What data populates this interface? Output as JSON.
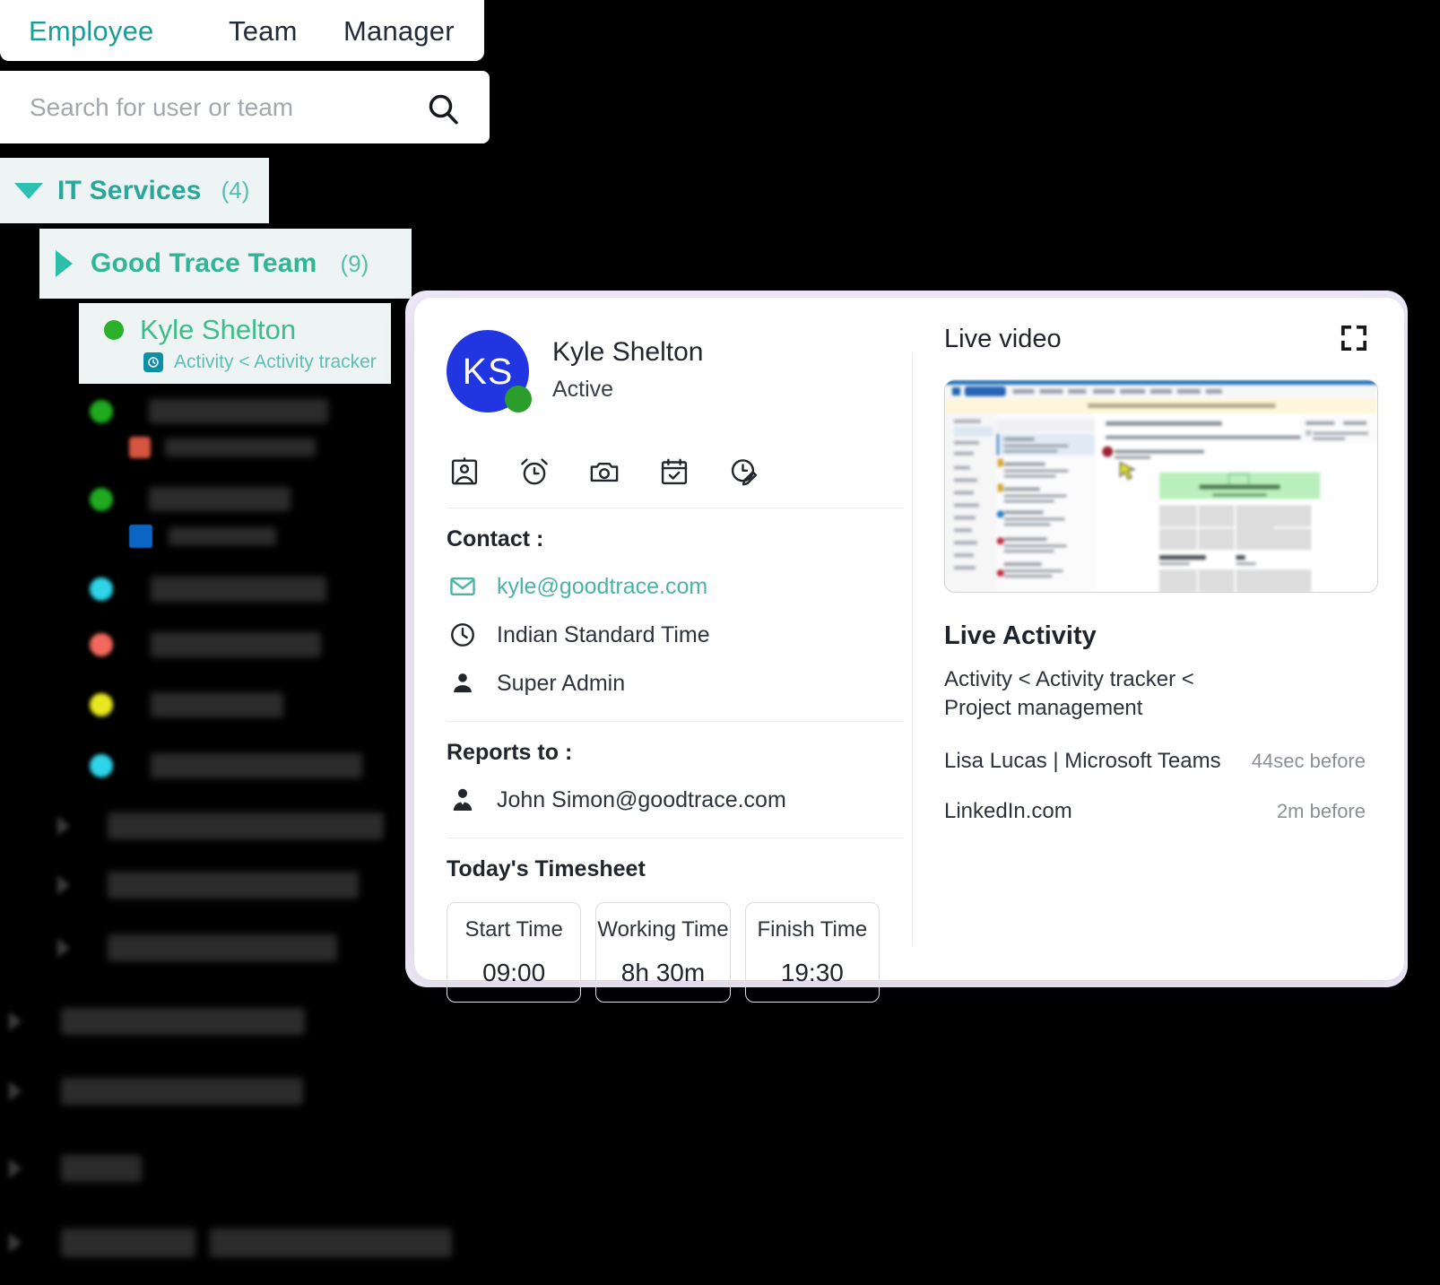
{
  "tabs": [
    {
      "label": "Employee",
      "active": true
    },
    {
      "label": "Team",
      "active": false
    },
    {
      "label": "Manager",
      "active": false
    }
  ],
  "search": {
    "placeholder": "Search for user or team",
    "value": "",
    "icon": "search-icon"
  },
  "tree": {
    "department": {
      "label": "IT Services",
      "count": "(4)",
      "expanded": true
    },
    "team": {
      "label": "Good Trace Team",
      "count": "(9)",
      "expanded": false
    },
    "selected_user": {
      "name": "Kyle Shelton",
      "presence": "online",
      "presence_color": "#2ab02a",
      "activity": "Activity < Activity tracker"
    }
  },
  "profile": {
    "avatar_initials": "KS",
    "avatar_color": "#2136e0",
    "presence_color": "#2a9d2a",
    "name": "Kyle Shelton",
    "status": "Active",
    "action_icons": [
      "id-badge-icon",
      "alarm-clock-icon",
      "camera-icon",
      "calendar-check-icon",
      "clock-edit-icon"
    ],
    "contact": {
      "heading": "Contact :",
      "email": "kyle@goodtrace.com",
      "timezone": "Indian Standard Time",
      "role": "Super Admin"
    },
    "reports_to": {
      "heading": "Reports to :",
      "value": "John Simon@goodtrace.com"
    },
    "timesheet": {
      "heading": "Today's Timesheet",
      "cards": [
        {
          "label": "Start Time",
          "value": "09:00"
        },
        {
          "label": "Working Time",
          "value": "8h 30m"
        },
        {
          "label": "Finish Time",
          "value": "19:30"
        }
      ]
    }
  },
  "live_video": {
    "title": "Live video",
    "fullscreen_icon": "fullscreen-icon"
  },
  "live_activity": {
    "title": "Live Activity",
    "breadcrumb": "Activity < Activity tracker < Project management",
    "items": [
      {
        "name": "Lisa Lucas | Microsoft Teams",
        "time": "44sec before"
      },
      {
        "name": "LinkedIn.com",
        "time": "2m before"
      }
    ]
  },
  "colors": {
    "accent_teal": "#2aa79b",
    "link_teal": "#4bb3a5",
    "avatar_blue": "#2136e0",
    "online_green": "#2ab02a",
    "card_halo": "#efeaf8"
  }
}
